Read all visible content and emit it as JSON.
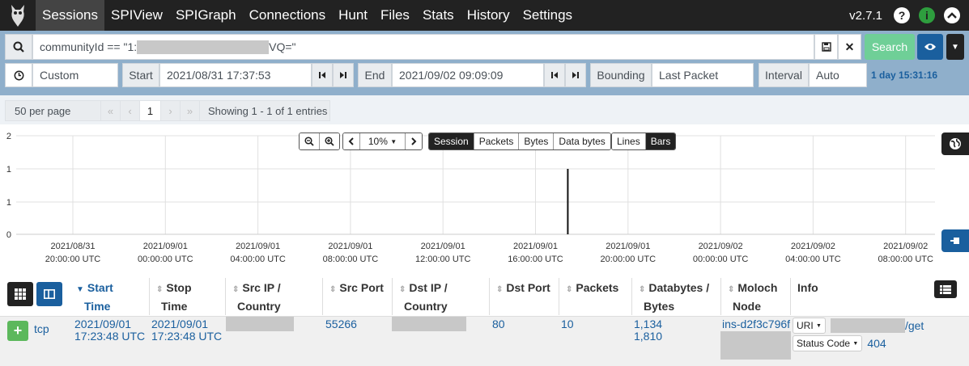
{
  "nav": {
    "items": [
      "Sessions",
      "SPIView",
      "SPIGraph",
      "Connections",
      "Hunt",
      "Files",
      "Stats",
      "History",
      "Settings"
    ],
    "active": "Sessions",
    "version": "v2.7.1",
    "help_icon": "?",
    "info_icon": "i",
    "collapse_icon": "chevron-up-icon"
  },
  "search": {
    "query_prefix": "communityId == \"1:",
    "query_suffix": "VQ=\"",
    "search_label": "Search"
  },
  "time": {
    "range_label": "Custom",
    "start_label": "Start",
    "start_value": "2021/08/31 17:37:53",
    "end_label": "End",
    "end_value": "2021/09/02 09:09:09",
    "bounding_label": "Bounding",
    "bounding_value": "Last Packet",
    "interval_label": "Interval",
    "interval_value": "Auto",
    "duration": "1 day 15:31:16"
  },
  "pagination": {
    "per_page": "50 per page",
    "first": "«",
    "prev": "‹",
    "current": "1",
    "next": "›",
    "last": "»",
    "showing": "Showing 1 - 1 of 1 entries"
  },
  "chart_toolbar": {
    "zoom": "10%",
    "metrics": [
      "Session",
      "Packets",
      "Bytes",
      "Data bytes"
    ],
    "metric_active": "Session",
    "styles": [
      "Lines",
      "Bars"
    ],
    "style_active": "Bars"
  },
  "chart_data": {
    "type": "bar",
    "y_ticks": [
      "2",
      "1",
      "1",
      "0"
    ],
    "ylim": [
      0,
      2
    ],
    "x_ticks": [
      {
        "date": "2021/08/31",
        "time": "20:00:00 UTC"
      },
      {
        "date": "2021/09/01",
        "time": "00:00:00 UTC"
      },
      {
        "date": "2021/09/01",
        "time": "04:00:00 UTC"
      },
      {
        "date": "2021/09/01",
        "time": "08:00:00 UTC"
      },
      {
        "date": "2021/09/01",
        "time": "12:00:00 UTC"
      },
      {
        "date": "2021/09/01",
        "time": "16:00:00 UTC"
      },
      {
        "date": "2021/09/01",
        "time": "20:00:00 UTC"
      },
      {
        "date": "2021/09/02",
        "time": "00:00:00 UTC"
      },
      {
        "date": "2021/09/02",
        "time": "04:00:00 UTC"
      },
      {
        "date": "2021/09/02",
        "time": "08:00:00 UTC"
      }
    ],
    "bars": [
      {
        "x": "2021/09/01 17:23:48",
        "value": 1
      }
    ]
  },
  "table": {
    "headers": [
      {
        "l1": "Start",
        "l2": "Time",
        "sorted": true
      },
      {
        "l1": "Stop",
        "l2": "Time"
      },
      {
        "l1": "Src IP /",
        "l2": "Country"
      },
      {
        "l1": "Src Port",
        "l2": ""
      },
      {
        "l1": "Dst IP /",
        "l2": "Country"
      },
      {
        "l1": "Dst Port",
        "l2": ""
      },
      {
        "l1": "Packets",
        "l2": ""
      },
      {
        "l1": "Databytes /",
        "l2": "Bytes"
      },
      {
        "l1": "Moloch",
        "l2": "Node"
      },
      {
        "l1": "Info",
        "l2": ""
      }
    ],
    "row": {
      "protocol": "tcp",
      "start_date": "2021/09/01",
      "start_time": "17:23:48 UTC",
      "stop_date": "2021/09/01",
      "stop_time": "17:23:48 UTC",
      "src_port": "55266",
      "dst_port": "80",
      "packets": "10",
      "databytes": "1,134",
      "bytes": "1,810",
      "node": "ins-d2f3c796f",
      "uri_label": "URI",
      "uri_suffix": "/get",
      "status_label": "Status Code",
      "status_value": "404"
    }
  }
}
